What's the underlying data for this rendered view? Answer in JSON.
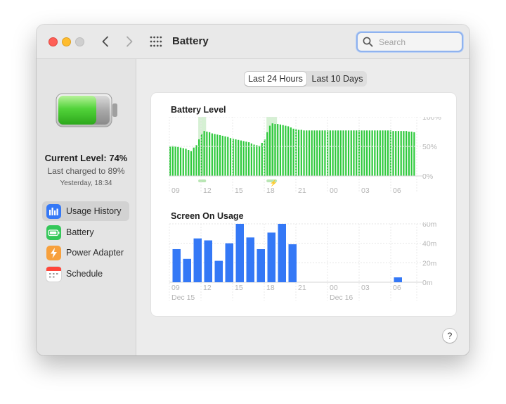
{
  "window": {
    "title": "Battery"
  },
  "search": {
    "placeholder": "Search"
  },
  "sidebar": {
    "current_level": "Current Level: 74%",
    "last_charged": "Last charged to 89%",
    "charged_time": "Yesterday, 18:34",
    "battery_fill_percent": 74,
    "items": [
      {
        "label": "Usage History",
        "icon": "usage-history-icon",
        "color": "#3478f6",
        "active": true
      },
      {
        "label": "Battery",
        "icon": "battery-icon",
        "color": "#34c759",
        "active": false
      },
      {
        "label": "Power Adapter",
        "icon": "power-adapter-icon",
        "color": "#f7a03c",
        "active": false
      },
      {
        "label": "Schedule",
        "icon": "calendar-icon",
        "color": "#ffffff",
        "active": false
      }
    ]
  },
  "range_tabs": {
    "selected": "Last 24 Hours",
    "other": "Last 10 Days"
  },
  "colors": {
    "battery_bar": "#2ec93c",
    "charging_band": "#d6f0d4",
    "screen_bar": "#3478f6"
  },
  "chart_data": [
    {
      "type": "bar",
      "title": "Battery Level",
      "x_tick_labels": [
        "09",
        "12",
        "15",
        "18",
        "21",
        "00",
        "03",
        "06"
      ],
      "y_tick_labels": [
        "100%",
        "50%",
        "0%"
      ],
      "ylim": [
        0,
        100
      ],
      "values": [
        50,
        51,
        50,
        49,
        48,
        47,
        46,
        44,
        42,
        48,
        52,
        62,
        71,
        76,
        75,
        74,
        72,
        71,
        70,
        69,
        68,
        67,
        66,
        64,
        63,
        62,
        61,
        60,
        59,
        58,
        57,
        55,
        53,
        52,
        51,
        56,
        62,
        74,
        85,
        89,
        88,
        88,
        87,
        86,
        85,
        84,
        82,
        80,
        79,
        78,
        78,
        77,
        77,
        77,
        77,
        77,
        77,
        77,
        77,
        77,
        77,
        77,
        77,
        77,
        77,
        77,
        77,
        77,
        77,
        77,
        77,
        77,
        77,
        77,
        77,
        77,
        77,
        77,
        77,
        77,
        77,
        77,
        77,
        77,
        77,
        76,
        76,
        76,
        76,
        76,
        76,
        75,
        75,
        74
      ],
      "charging_periods": [
        [
          11,
          13
        ],
        [
          37,
          40
        ]
      ],
      "charging_symbol": "⚡",
      "grid": true
    },
    {
      "type": "bar",
      "title": "Screen On Usage",
      "x_tick_labels": [
        "09",
        "12",
        "15",
        "18",
        "21",
        "00",
        "03",
        "06"
      ],
      "date_labels": [
        "Dec 15",
        "Dec 16"
      ],
      "y_tick_labels": [
        "60m",
        "40m",
        "20m",
        "0m"
      ],
      "unit": "m",
      "ylim": [
        0,
        60
      ],
      "hours": [
        "09",
        "10",
        "11",
        "12",
        "13",
        "14",
        "15",
        "16",
        "17",
        "18",
        "19",
        "20",
        "21",
        "22",
        "23",
        "00",
        "01",
        "02",
        "03",
        "04",
        "05",
        "06",
        "07"
      ],
      "values": [
        34,
        24,
        45,
        43,
        22,
        40,
        60,
        46,
        34,
        51,
        60,
        39,
        0,
        0,
        0,
        0,
        0,
        0,
        0,
        0,
        0,
        5,
        0
      ],
      "grid": true
    }
  ]
}
